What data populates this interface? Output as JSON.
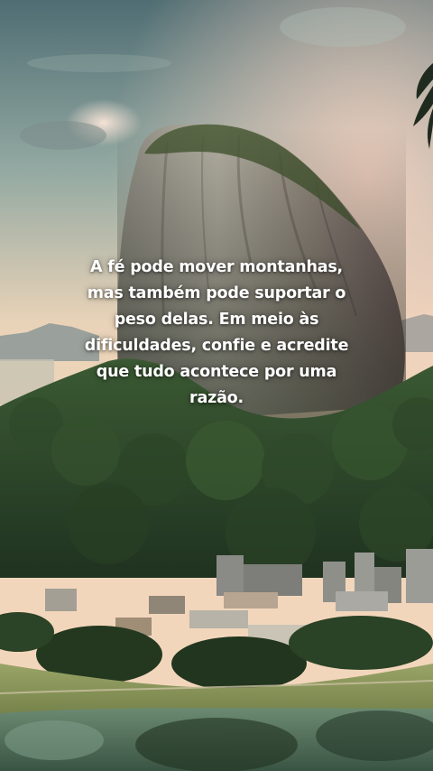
{
  "quote": {
    "lines": [
      "A fé pode mover montanhas,",
      "mas também pode suportar o",
      "peso delas. Em meio às",
      "dificuldades, confie e acredite",
      "que tudo acontece por uma",
      "razão."
    ]
  },
  "colors": {
    "sky_top": "#5d7b80",
    "sky_warm": "#f0d3b4",
    "rock": "#9e9a8e",
    "forest": "#2e4a2c",
    "lawn": "#8e9a5a",
    "water": "#5f7f6a",
    "text": "#ffffff"
  }
}
